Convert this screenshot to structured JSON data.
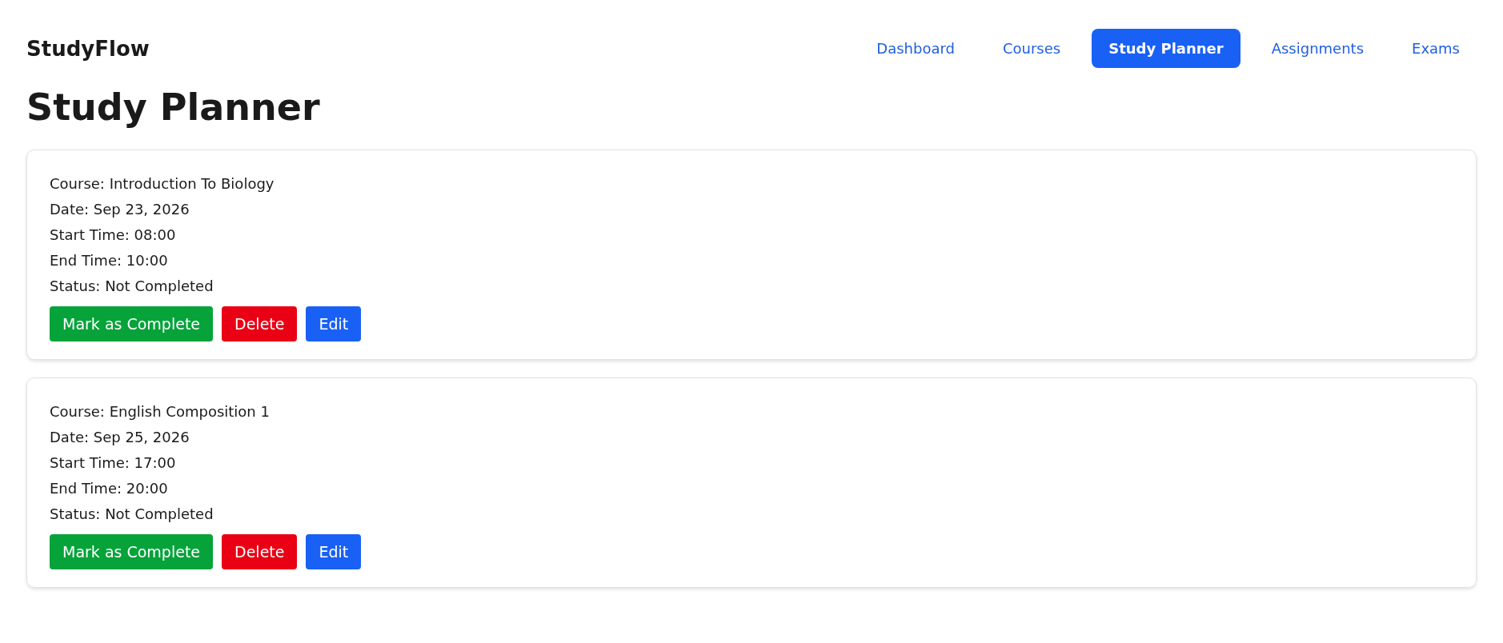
{
  "brand": "StudyFlow",
  "nav": [
    {
      "label": "Dashboard",
      "selected": false
    },
    {
      "label": "Courses",
      "selected": false
    },
    {
      "label": "Study Planner",
      "selected": true
    },
    {
      "label": "Assignments",
      "selected": false
    },
    {
      "label": "Exams",
      "selected": false
    }
  ],
  "page_title": "Study Planner",
  "sessions": [
    {
      "lines": [
        "Course: Introduction To Biology",
        "Date: Sep 23, 2026",
        "Start Time: 08:00",
        "End Time: 10:00",
        "Status: Not Completed"
      ],
      "buttons": [
        {
          "label": "Mark as Complete",
          "kind": "complete"
        },
        {
          "label": "Delete",
          "kind": "delete"
        },
        {
          "label": "Edit",
          "kind": "edit"
        }
      ]
    },
    {
      "lines": [
        "Course: English Composition 1",
        "Date: Sep 25, 2026",
        "Start Time: 17:00",
        "End Time: 20:00",
        "Status: Not Completed"
      ],
      "buttons": [
        {
          "label": "Mark as Complete",
          "kind": "complete"
        },
        {
          "label": "Delete",
          "kind": "delete"
        },
        {
          "label": "Edit",
          "kind": "edit"
        }
      ]
    }
  ]
}
